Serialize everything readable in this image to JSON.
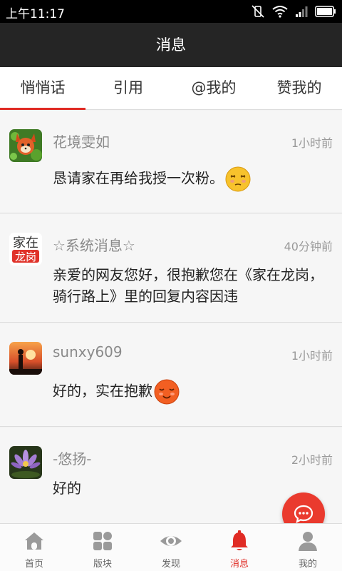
{
  "status_bar": {
    "time": "上午11:17"
  },
  "header": {
    "title": "消息"
  },
  "tabs": [
    {
      "label": "悄悄话"
    },
    {
      "label": "引用"
    },
    {
      "label": "@我的"
    },
    {
      "label": "赞我的"
    }
  ],
  "messages": [
    {
      "name": "花境雯如",
      "time": "1小时前",
      "text": "恳请家在再给我授一次粉。"
    },
    {
      "name": "☆系统消息☆",
      "time": "40分钟前",
      "text": "亲爱的网友您好，很抱歉您在《家在龙岗，骑行路上》里的回复内容因违"
    },
    {
      "name": "sunxy609",
      "time": "1小时前",
      "text": "好的，实在抱歉"
    },
    {
      "name": "-悠扬-",
      "time": "2小时前",
      "text": "好的"
    }
  ],
  "logo_text": {
    "top": "家在",
    "bottom": "龙岗"
  },
  "bottom_nav": [
    {
      "label": "首页"
    },
    {
      "label": "版块"
    },
    {
      "label": "发现"
    },
    {
      "label": "消息"
    },
    {
      "label": "我的"
    }
  ],
  "colors": {
    "accent": "#e02b24",
    "title_bar": "#252525",
    "fab": "#ea3a2e"
  }
}
